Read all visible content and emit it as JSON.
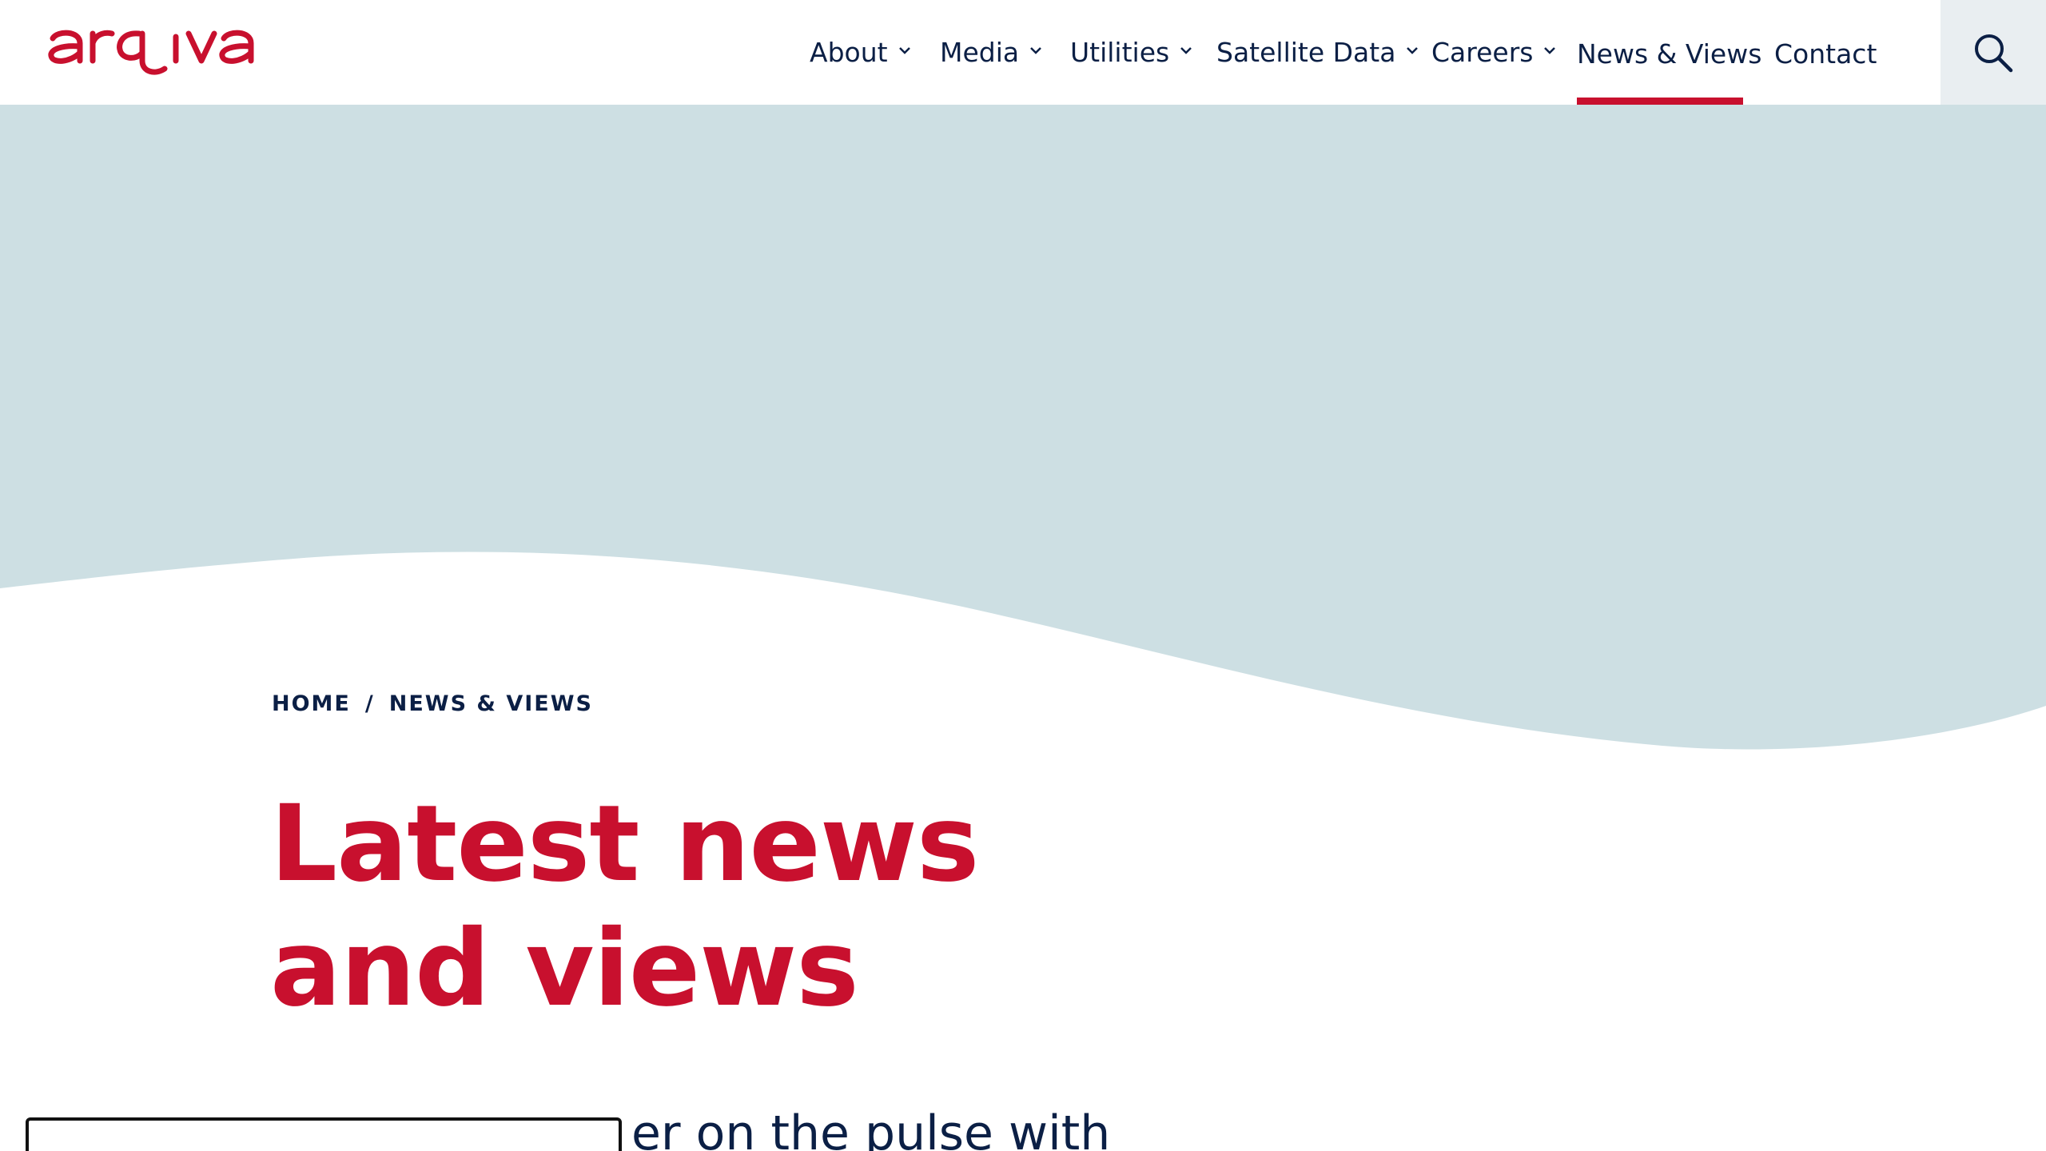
{
  "brand": {
    "logo_text": "arqiva",
    "color": "#c8102e"
  },
  "nav": {
    "items": [
      {
        "label": "About",
        "has_dropdown": true
      },
      {
        "label": "Media",
        "has_dropdown": true
      },
      {
        "label": "Utilities",
        "has_dropdown": true
      },
      {
        "label": "Satellite Data",
        "has_dropdown": true
      },
      {
        "label": "Careers",
        "has_dropdown": true
      },
      {
        "label": "News & Views",
        "has_dropdown": false,
        "active": true
      },
      {
        "label": "Contact",
        "has_dropdown": false
      }
    ],
    "search_icon": "search-icon"
  },
  "breadcrumb": {
    "home": "HOME",
    "separator": "/",
    "current": "NEWS & VIEWS"
  },
  "page": {
    "title": "Latest news and views",
    "lead_visible": "er on the pulse with"
  },
  "colors": {
    "accent": "#c8102e",
    "navy": "#0b1f45",
    "hero_bg": "#cddfe3",
    "search_bg": "#e9eef1"
  }
}
